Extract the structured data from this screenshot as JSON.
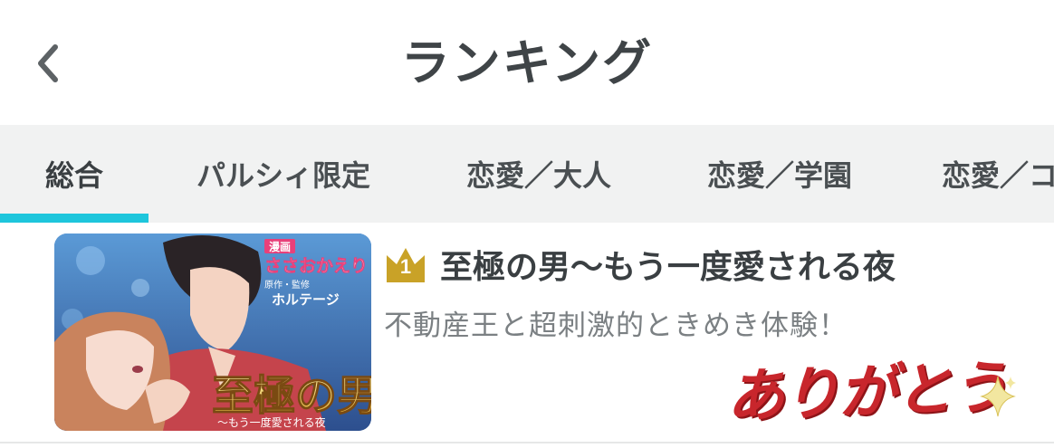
{
  "header": {
    "title": "ランキング"
  },
  "tabs": [
    {
      "label": "総合",
      "active": true
    },
    {
      "label": "パルシィ限定",
      "active": false
    },
    {
      "label": "恋愛／大人",
      "active": false
    },
    {
      "label": "恋愛／学園",
      "active": false
    },
    {
      "label": "恋愛／コ",
      "active": false
    }
  ],
  "ranking": [
    {
      "rank": "1",
      "title": "至極の男〜もう一度愛される夜",
      "description": "不動産王と超刺激的ときめき体験！",
      "cover": {
        "credit_label_manga": "漫画",
        "author": "ささおかえり",
        "credit_label_original": "原作・監修",
        "supervisor": "ホルテージ",
        "cover_title": "至極の男",
        "cover_subtitle": "〜もう一度愛される夜"
      },
      "sticker": "ありがとう"
    }
  ],
  "colors": {
    "accent": "#1ec6dc",
    "tab_bar_bg": "#f1f2f2",
    "rank_gold": "#c9a227",
    "sticker_red": "#c8262c"
  }
}
